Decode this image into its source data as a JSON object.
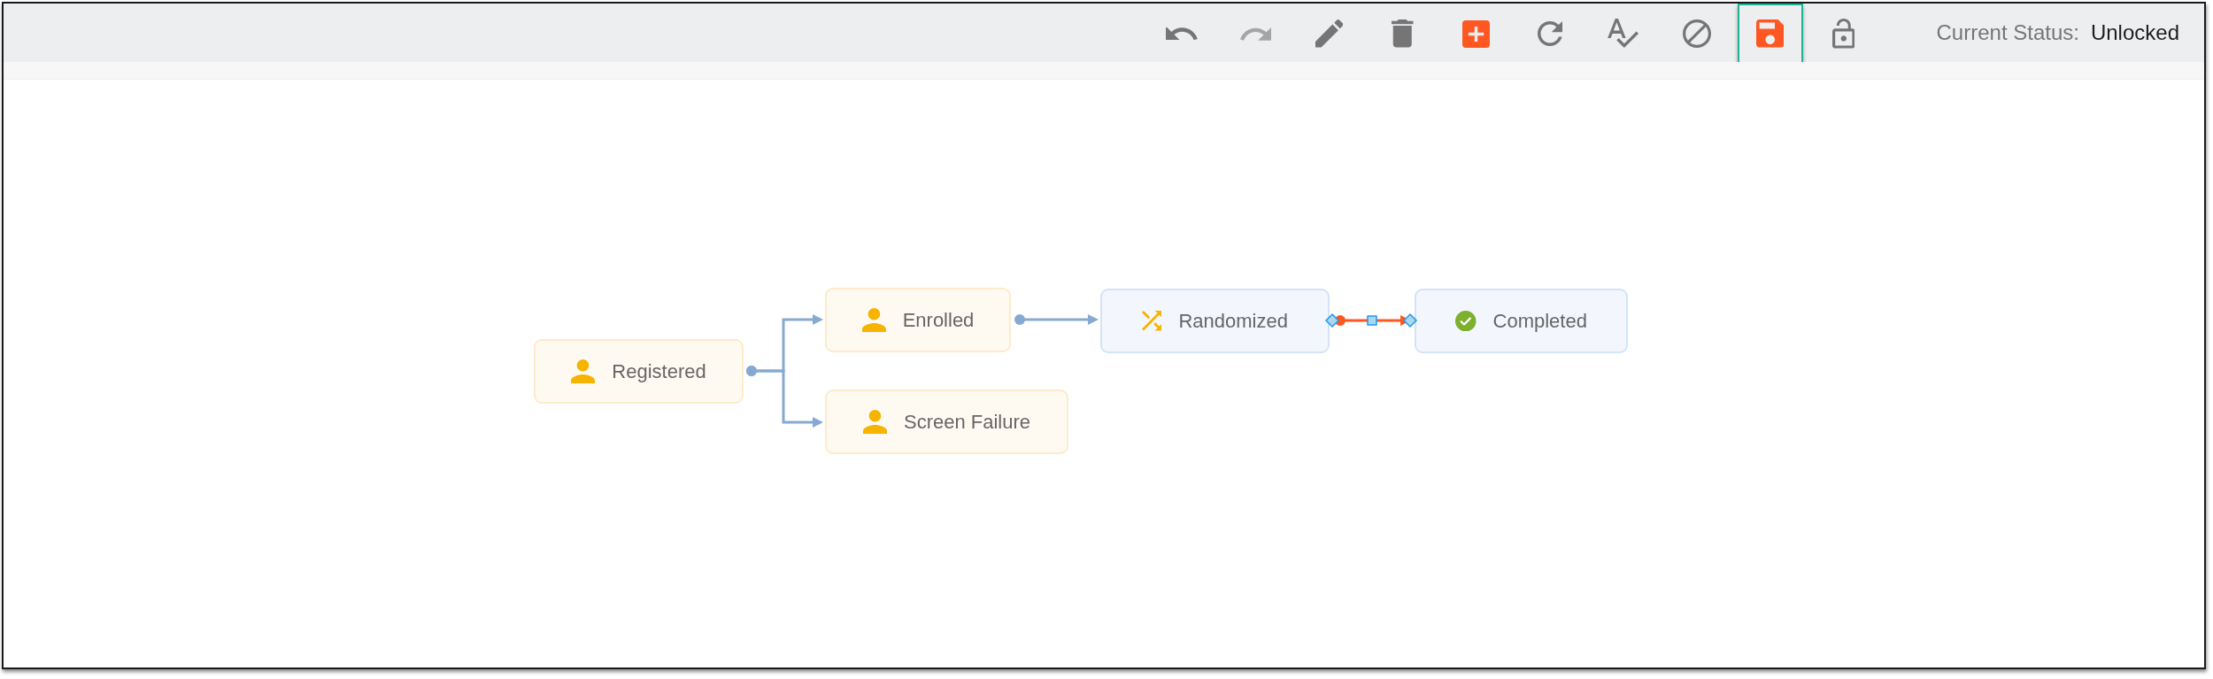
{
  "toolbar": {
    "buttons": [
      {
        "disabled": false,
        "selected": false
      },
      {
        "disabled": true,
        "selected": false
      },
      {
        "disabled": false,
        "selected": false
      },
      {
        "disabled": false,
        "selected": false
      },
      {
        "disabled": false,
        "selected": false
      },
      {
        "disabled": false,
        "selected": false
      },
      {
        "disabled": false,
        "selected": false
      },
      {
        "disabled": false,
        "selected": false
      },
      {
        "disabled": false,
        "selected": true
      },
      {
        "disabled": false,
        "selected": false
      }
    ],
    "status_label": "Current Status:",
    "status_value": "Unlocked"
  },
  "diagram": {
    "nodes": [
      {
        "label": "Registered"
      },
      {
        "label": "Enrolled"
      },
      {
        "label": "Screen Failure"
      },
      {
        "label": "Randomized"
      },
      {
        "label": "Completed"
      }
    ],
    "edges": [
      {
        "selected": false
      },
      {
        "selected": false
      },
      {
        "selected": false
      },
      {
        "selected": true
      }
    ]
  }
}
